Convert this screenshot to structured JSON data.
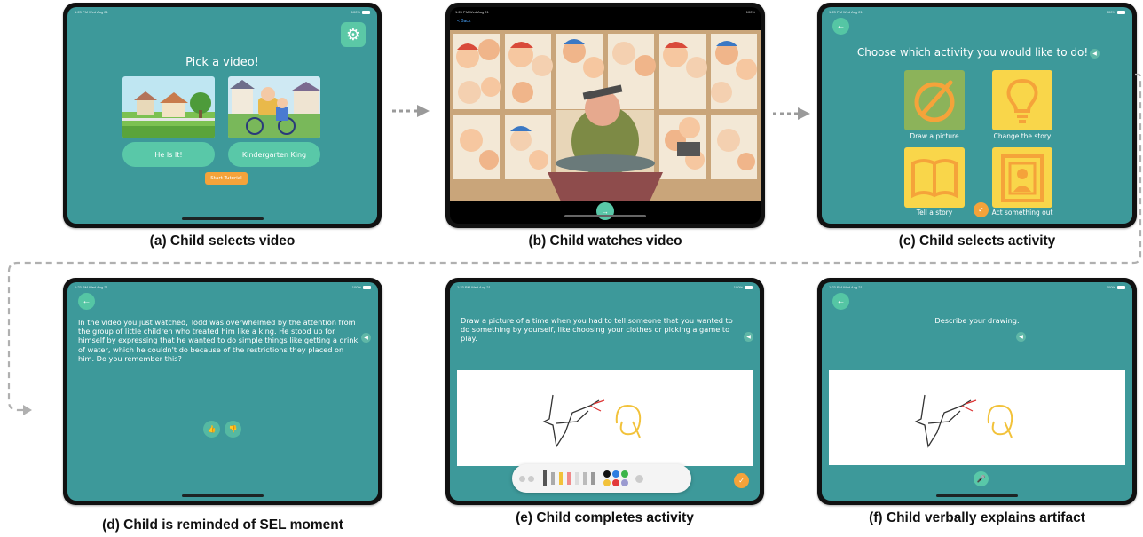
{
  "captions": {
    "a": "(a) Child selects video",
    "b": "(b) Child watches video",
    "c": "(c) Child selects activity",
    "d": "(d) Child is reminded of SEL moment",
    "e": "(e) Child completes activity",
    "f": "(f) Child verbally explains artifact"
  },
  "status": {
    "time": "1:23 PM  Wed Aug 21",
    "battery": "100%"
  },
  "panel_a": {
    "title": "Pick a video!",
    "videos": [
      "He Is It!",
      "Kindergarten King"
    ],
    "tutorial_button": "Start Tutorial",
    "icons": {
      "settings": "gear-icon"
    }
  },
  "panel_b": {
    "back_label": "< Back",
    "icons": {
      "play": "play-icon"
    }
  },
  "panel_c": {
    "title": "Choose which activity you would like to do!",
    "activities": [
      "Draw a picture",
      "Change the story",
      "Tell a story",
      "Act something out"
    ],
    "tile_colors": [
      "#8cb35a",
      "#f9d64a",
      "#f9d64a",
      "#f9d64a"
    ]
  },
  "panel_d": {
    "text": "In the video you just watched, Todd was overwhelmed by the attention from the group of little children who treated him like a king. He stood up for himself by expressing that he wanted to do simple things like getting a drink of water, which he couldn't do because of the restrictions they placed on him. Do you remember this?"
  },
  "panel_e": {
    "text": "Draw a picture of a time when you had to tell someone that you wanted to do something by yourself, like choosing your clothes or picking a game to play."
  },
  "panel_f": {
    "text": "Describe your drawing."
  },
  "colors": {
    "screen": "#3d999a",
    "button": "#59c8a8",
    "accent": "#f5a33a"
  }
}
